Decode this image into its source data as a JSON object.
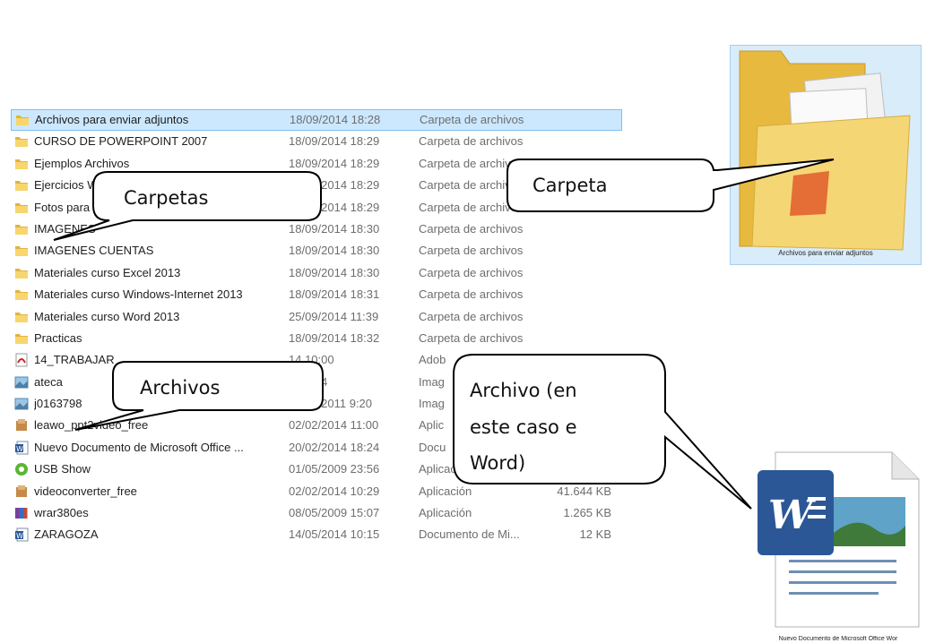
{
  "files": [
    {
      "name": "Archivos  para enviar adjuntos",
      "date": "18/09/2014 18:28",
      "type": "Carpeta de archivos",
      "size": "",
      "icon": "folder-icon",
      "selected": true
    },
    {
      "name": "CURSO DE POWERPOINT 2007",
      "date": "18/09/2014 18:29",
      "type": "Carpeta de archivos",
      "size": "",
      "icon": "folder-icon"
    },
    {
      "name": "Ejemplos Archivos",
      "date": "18/09/2014 18:29",
      "type": "Carpeta de archivos",
      "size": "",
      "icon": "folder-icon"
    },
    {
      "name": "Ejercicios W",
      "date": "18/09/2014 18:29",
      "type": "Carpeta de archivos",
      "size": "",
      "icon": "folder-icon"
    },
    {
      "name": "Fotos para",
      "date": "18/09/2014 18:29",
      "type": "Carpeta de archivos",
      "size": "",
      "icon": "folder-icon"
    },
    {
      "name": "IMAGENES",
      "date": "18/09/2014 18:30",
      "type": "Carpeta de archivos",
      "size": "",
      "icon": "folder-icon"
    },
    {
      "name": "IMAGENES CUENTAS",
      "date": "18/09/2014 18:30",
      "type": "Carpeta de archivos",
      "size": "",
      "icon": "folder-icon"
    },
    {
      "name": "Materiales curso Excel 2013",
      "date": "18/09/2014 18:30",
      "type": "Carpeta de archivos",
      "size": "",
      "icon": "folder-icon"
    },
    {
      "name": "Materiales curso Windows-Internet 2013",
      "date": "18/09/2014 18:31",
      "type": "Carpeta de archivos",
      "size": "",
      "icon": "folder-icon"
    },
    {
      "name": "Materiales curso Word 2013",
      "date": "25/09/2014 11:39",
      "type": "Carpeta de archivos",
      "size": "",
      "icon": "folder-icon"
    },
    {
      "name": "Practicas",
      "date": "18/09/2014 18:32",
      "type": "Carpeta de archivos",
      "size": "",
      "icon": "folder-icon"
    },
    {
      "name": "14_TRABAJAR",
      "date": "14 10:00",
      "type": "Adob",
      "size": "",
      "icon": "pdf-icon"
    },
    {
      "name": "ateca",
      "date": "14 9:44",
      "type": "Imag",
      "size": "",
      "icon": "image-icon"
    },
    {
      "name": "j0163798",
      "date": "20/02/2011 9:20",
      "type": "Imag",
      "size": "",
      "icon": "image-icon"
    },
    {
      "name": "leawo_ppt2video_free",
      "date": "02/02/2014 11:00",
      "type": "Aplic",
      "size": "",
      "icon": "installer-icon"
    },
    {
      "name": "Nuevo Documento de Microsoft Office ...",
      "date": "20/02/2014 18:24",
      "type": "Docu",
      "size": "",
      "icon": "word-doc-icon"
    },
    {
      "name": "USB Show",
      "date": "01/05/2009 23:56",
      "type": "Aplicac",
      "size": "",
      "icon": "usbshow-icon"
    },
    {
      "name": "videoconverter_free",
      "date": "02/02/2014 10:29",
      "type": "Aplicación",
      "size": "41.644 KB",
      "icon": "installer-icon"
    },
    {
      "name": "wrar380es",
      "date": "08/05/2009 15:07",
      "type": "Aplicación",
      "size": "1.265 KB",
      "icon": "winrar-icon"
    },
    {
      "name": "ZARAGOZA",
      "date": "14/05/2014 10:15",
      "type": "Documento de Mi...",
      "size": "12 KB",
      "icon": "word-doc-icon"
    }
  ],
  "callouts": {
    "carpetas": "Carpetas",
    "carpeta": "Carpeta",
    "archivos": "Archivos",
    "archivo_line1": "Archivo (en",
    "archivo_line2": "este caso e",
    "archivo_line3": "Word)"
  },
  "big_folder": {
    "caption": "Archivos  para enviar adjuntos"
  },
  "big_word": {
    "caption": "Nuevo Documento de Microsoft Office Wor"
  },
  "colors": {
    "selection": "#cce8ff",
    "selection_border": "#7ec0ee",
    "folder": "#f3d36b",
    "word_blue": "#2b5797"
  }
}
